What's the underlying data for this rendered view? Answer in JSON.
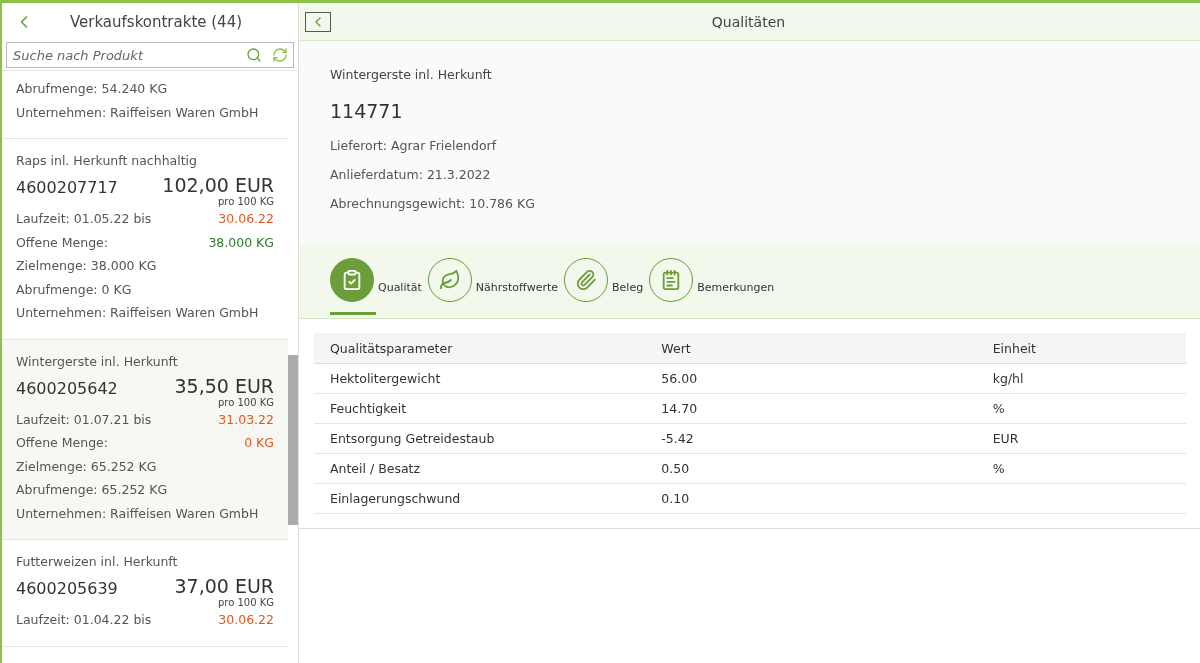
{
  "master": {
    "title": "Verkaufskontrakte (44)",
    "search": {
      "placeholder": "Suche nach Produkt"
    },
    "items": [
      {
        "selected": false,
        "abrufmenge": "Abrufmenge: 54.240 KG",
        "unternehmen": "Unternehmen: Raiffeisen Waren GmbH"
      },
      {
        "selected": false,
        "product": "Raps inl. Herkunft nachhaltig",
        "number": "4600207717",
        "price": "102,00 EUR",
        "unit": "pro 100 KG",
        "laufzeit": "Laufzeit: 01.05.22 bis",
        "laufzeit_end": {
          "text": "30.06.22",
          "color": "#e0591f"
        },
        "offen_label": "Offene Menge:",
        "offen_value": {
          "text": "38.000 KG",
          "color": "#2b7c2b"
        },
        "zielmenge": "Zielmenge: 38.000 KG",
        "abrufmenge": "Abrufmenge: 0 KG",
        "unternehmen": "Unternehmen: Raiffeisen Waren GmbH"
      },
      {
        "selected": true,
        "product": "Wintergerste inl. Herkunft",
        "number": "4600205642",
        "price": "35,50 EUR",
        "unit": "pro 100 KG",
        "laufzeit": "Laufzeit: 01.07.21 bis",
        "laufzeit_end": {
          "text": "31.03.22",
          "color": "#e0591f"
        },
        "offen_label": "Offene Menge:",
        "offen_value": {
          "text": "0 KG",
          "color": "#e0591f"
        },
        "zielmenge": "Zielmenge: 65.252 KG",
        "abrufmenge": "Abrufmenge: 65.252 KG",
        "unternehmen": "Unternehmen: Raiffeisen Waren GmbH"
      },
      {
        "selected": false,
        "product": "Futterweizen inl. Herkunft",
        "number": "4600205639",
        "price": "37,00 EUR",
        "unit": "pro 100 KG",
        "laufzeit": "Laufzeit: 01.04.22 bis",
        "laufzeit_end": {
          "text": "30.06.22",
          "color": "#e0591f"
        }
      }
    ]
  },
  "detail": {
    "title": "Qualitäten",
    "product": "Wintergerste inl. Herkunft",
    "number": "114771",
    "attributes": [
      "Lieferort: Agrar Frielendorf",
      "Anlieferdatum: 21.3.2022",
      "Abrechnungsgewicht: 10.786 KG"
    ],
    "tabs": [
      {
        "kind": "clipboard",
        "label": "Qualität",
        "selected": true
      },
      {
        "kind": "leaf",
        "label": "Nährstoffwerte",
        "selected": false
      },
      {
        "kind": "paperclip",
        "label": "Beleg",
        "selected": false
      },
      {
        "kind": "notes",
        "label": "Bemerkungen",
        "selected": false
      }
    ],
    "table": {
      "columns": [
        "Qualitätsparameter",
        "Wert",
        "Einheit"
      ],
      "rows": [
        [
          "Hektolitergewicht",
          "56.00",
          "kg/hl"
        ],
        [
          "Feuchtigkeit",
          "14.70",
          "%"
        ],
        [
          "Entsorgung Getreidestaub",
          "-5.42",
          "EUR"
        ],
        [
          "Anteil / Besatz",
          "0.50",
          "%"
        ],
        [
          "Einlagerungschwund",
          "0.10",
          ""
        ]
      ]
    }
  }
}
